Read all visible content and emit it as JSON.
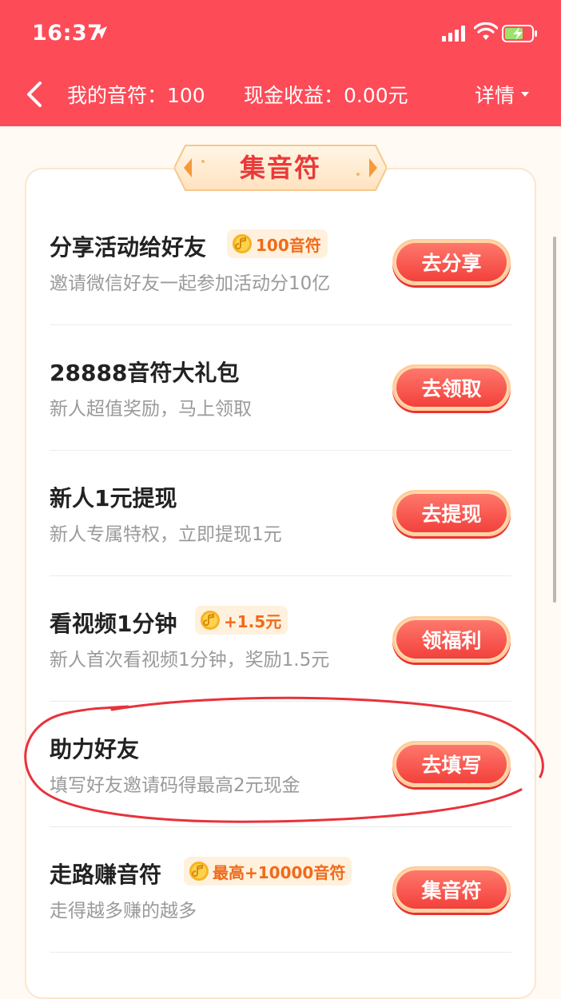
{
  "status_bar": {
    "time": "16:37",
    "icons": [
      "location-arrow-icon",
      "signal-icon",
      "wifi-icon",
      "battery-charging-icon"
    ]
  },
  "nav": {
    "my_notes": "我的音符：100",
    "cash_income": "现金收益：0.00元",
    "detail": "详情"
  },
  "section": {
    "title": "集音符"
  },
  "tasks": [
    {
      "title": "分享活动给好友",
      "badge": "100音符",
      "subtitle": "邀请微信好友一起参加活动分10亿",
      "button": "去分享"
    },
    {
      "title": "28888音符大礼包",
      "badge": "",
      "subtitle": "新人超值奖励，马上领取",
      "button": "去领取"
    },
    {
      "title": "新人1元提现",
      "badge": "",
      "subtitle": "新人专属特权，立即提现1元",
      "button": "去提现"
    },
    {
      "title": "看视频1分钟",
      "badge": "+1.5元",
      "subtitle": "新人首次看视频1分钟，奖励1.5元",
      "button": "领福利"
    },
    {
      "title": "助力好友",
      "badge": "",
      "subtitle": "填写好友邀请码得最高2元现金",
      "button": "去填写"
    },
    {
      "title": "走路赚音符",
      "badge": "最高+10000音符",
      "subtitle": "走得越多赚的越多",
      "button": "集音符"
    }
  ],
  "colors": {
    "header": "#fd4b58",
    "button": "#f23d39",
    "badge_text": "#f06a1b",
    "annotation": "#e8323c"
  }
}
